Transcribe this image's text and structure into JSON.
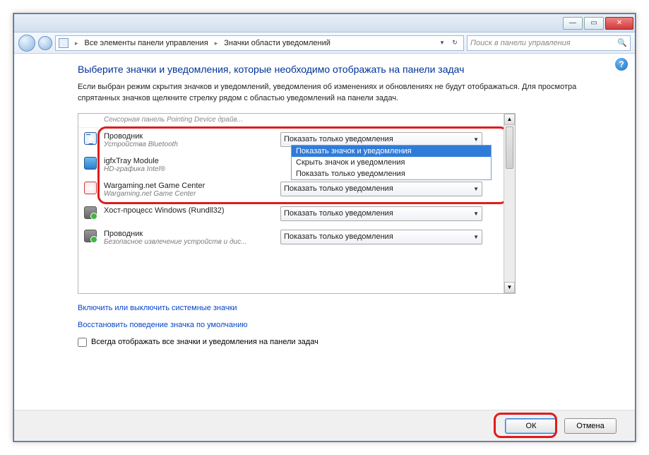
{
  "titlebar": {
    "min": "—",
    "max": "▭",
    "close": "✕"
  },
  "nav": {
    "crumb1": "Все элементы панели управления",
    "crumb2": "Значки области уведомлений",
    "search_placeholder": "Поиск в панели управления"
  },
  "main": {
    "heading": "Выберите значки и уведомления, которые необходимо отображать на панели задач",
    "description": "Если выбран режим скрытия значков и уведомлений, уведомления об изменениях и обновлениях не будут отображаться. Для просмотра спрятанных значков щелкните стрелку рядом с областью уведомлений на панели задач.",
    "cutoff_row": "Сенсорная панель Pointing Device драйв...",
    "rows": [
      {
        "name": "Проводник",
        "sub": "Устройства Bluetooth",
        "combo": "Показать только уведомления",
        "icon": "ic-bt"
      },
      {
        "name": "igfxTray Module",
        "sub": "HD-графика Intel®",
        "combo": "",
        "icon": "ic-ig"
      },
      {
        "name": "Wargaming.net Game Center",
        "sub": "Wargaming.net Game Center",
        "combo": "Показать только уведомления",
        "icon": "ic-wg"
      },
      {
        "name": "Хост-процесс Windows (Rundll32)",
        "sub": "",
        "combo": "Показать только уведомления",
        "icon": "ic-usb"
      },
      {
        "name": "Проводник",
        "sub": "Безопасное извлечение устройств и дис...",
        "combo": "Показать только уведомления",
        "icon": "ic-usb"
      }
    ],
    "dropdown": {
      "options": [
        "Показать значок и уведомления",
        "Скрыть значок и уведомления",
        "Показать только уведомления"
      ],
      "selected_index": 0
    },
    "link1": "Включить или выключить системные значки",
    "link2": "Восстановить поведение значка по умолчанию",
    "chk_label": "Всегда отображать все значки и уведомления на панели задач"
  },
  "buttons": {
    "ok": "ОК",
    "cancel": "Отмена"
  }
}
